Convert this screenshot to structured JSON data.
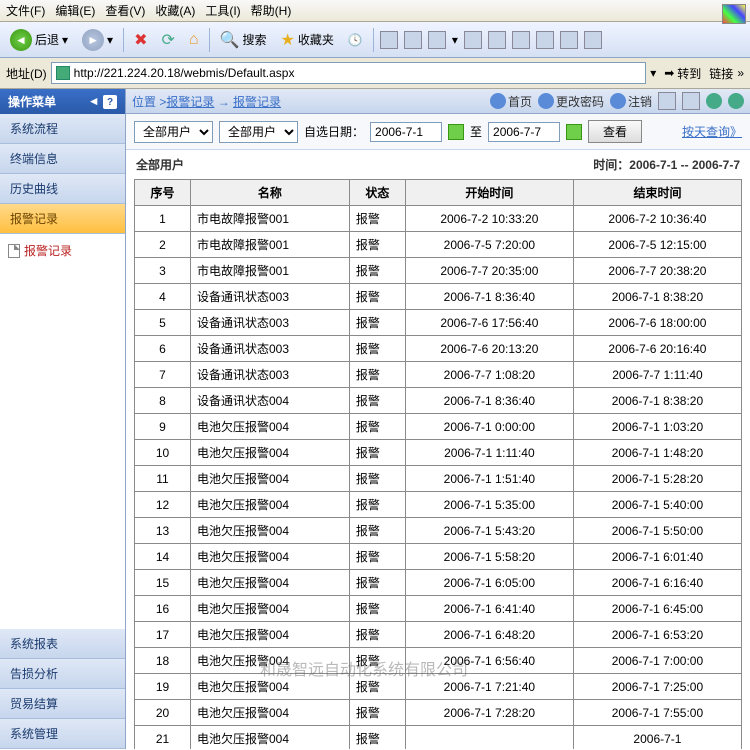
{
  "menubar": [
    "文件(F)",
    "编辑(E)",
    "查看(V)",
    "收藏(A)",
    "工具(I)",
    "帮助(H)"
  ],
  "toolbar": {
    "back": "后退",
    "search": "搜索",
    "favorites": "收藏夹"
  },
  "address": {
    "label": "地址(D)",
    "url": "http://221.224.20.18/webmis/Default.aspx",
    "go": "转到",
    "links": "链接"
  },
  "sidebar": {
    "title": "操作菜单",
    "items": [
      "系统流程",
      "终端信息",
      "历史曲线",
      "报警记录"
    ],
    "bottom": [
      "系统报表",
      "告损分析",
      "贸易结算",
      "系统管理"
    ],
    "sub": "报警记录"
  },
  "breadcrumb": {
    "prefix": "位置",
    "a": "报警记录",
    "b": "报警记录"
  },
  "topright": {
    "home": "首页",
    "pwd": "更改密码",
    "logout": "注销"
  },
  "filter": {
    "sel1": "全部用户",
    "sel2": "全部用户",
    "datelabel": "自选日期：",
    "from": "2006-7-1",
    "to_lbl": "至",
    "to": "2006-7-7",
    "go": "查看",
    "byday": "按天查询"
  },
  "table": {
    "caption": "全部用户",
    "timelabel": "时间：2006-7-1 -- 2006-7-7",
    "headers": [
      "序号",
      "名称",
      "状态",
      "开始时间",
      "结束时间"
    ],
    "rows": [
      [
        "1",
        "市电故障报警001",
        "报警",
        "2006-7-2 10:33:20",
        "2006-7-2 10:36:40"
      ],
      [
        "2",
        "市电故障报警001",
        "报警",
        "2006-7-5 7:20:00",
        "2006-7-5 12:15:00"
      ],
      [
        "3",
        "市电故障报警001",
        "报警",
        "2006-7-7 20:35:00",
        "2006-7-7 20:38:20"
      ],
      [
        "4",
        "设备通讯状态003",
        "报警",
        "2006-7-1 8:36:40",
        "2006-7-1 8:38:20"
      ],
      [
        "5",
        "设备通讯状态003",
        "报警",
        "2006-7-6 17:56:40",
        "2006-7-6 18:00:00"
      ],
      [
        "6",
        "设备通讯状态003",
        "报警",
        "2006-7-6 20:13:20",
        "2006-7-6 20:16:40"
      ],
      [
        "7",
        "设备通讯状态003",
        "报警",
        "2006-7-7 1:08:20",
        "2006-7-7 1:11:40"
      ],
      [
        "8",
        "设备通讯状态004",
        "报警",
        "2006-7-1 8:36:40",
        "2006-7-1 8:38:20"
      ],
      [
        "9",
        "电池欠压报警004",
        "报警",
        "2006-7-1 0:00:00",
        "2006-7-1 1:03:20"
      ],
      [
        "10",
        "电池欠压报警004",
        "报警",
        "2006-7-1 1:11:40",
        "2006-7-1 1:48:20"
      ],
      [
        "11",
        "电池欠压报警004",
        "报警",
        "2006-7-1 1:51:40",
        "2006-7-1 5:28:20"
      ],
      [
        "12",
        "电池欠压报警004",
        "报警",
        "2006-7-1 5:35:00",
        "2006-7-1 5:40:00"
      ],
      [
        "13",
        "电池欠压报警004",
        "报警",
        "2006-7-1 5:43:20",
        "2006-7-1 5:50:00"
      ],
      [
        "14",
        "电池欠压报警004",
        "报警",
        "2006-7-1 5:58:20",
        "2006-7-1 6:01:40"
      ],
      [
        "15",
        "电池欠压报警004",
        "报警",
        "2006-7-1 6:05:00",
        "2006-7-1 6:16:40"
      ],
      [
        "16",
        "电池欠压报警004",
        "报警",
        "2006-7-1 6:41:40",
        "2006-7-1 6:45:00"
      ],
      [
        "17",
        "电池欠压报警004",
        "报警",
        "2006-7-1 6:48:20",
        "2006-7-1 6:53:20"
      ],
      [
        "18",
        "电池欠压报警004",
        "报警",
        "2006-7-1 6:56:40",
        "2006-7-1 7:00:00"
      ],
      [
        "19",
        "电池欠压报警004",
        "报警",
        "2006-7-1 7:21:40",
        "2006-7-1 7:25:00"
      ],
      [
        "20",
        "电池欠压报警004",
        "报警",
        "2006-7-1 7:28:20",
        "2006-7-1 7:55:00"
      ],
      [
        "21",
        "电池欠压报警004",
        "报警",
        "",
        "2006-7-1 "
      ]
    ]
  },
  "watermark": "和晟智远自动化系统有限公司"
}
